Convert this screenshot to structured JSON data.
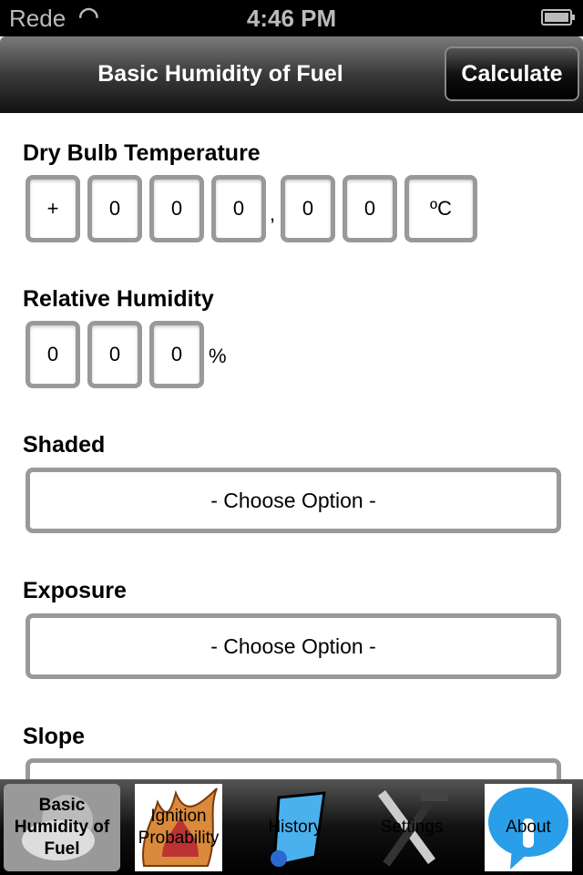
{
  "status_bar": {
    "carrier": "Rede",
    "time": "4:46 PM",
    "wifi_icon": "wifi-icon",
    "battery_icon": "battery-icon"
  },
  "nav": {
    "title": "Basic Humidity of Fuel",
    "calculate_label": "Calculate"
  },
  "dry_bulb": {
    "label": "Dry Bulb Temperature",
    "sign": "+",
    "digits": [
      "0",
      "0",
      "0",
      "0",
      "0"
    ],
    "decimal_separator": ",",
    "unit": "ºC"
  },
  "humidity": {
    "label": "Relative Humidity",
    "digits": [
      "0",
      "0",
      "0"
    ],
    "unit": "%"
  },
  "shaded": {
    "label": "Shaded",
    "value": "- Choose Option -"
  },
  "exposure": {
    "label": "Exposure",
    "value": "- Choose Option -"
  },
  "slope": {
    "label": "Slope"
  },
  "tabs": [
    {
      "label": "Basic Humidity of Fuel",
      "selected": true
    },
    {
      "label": "Ignition Probability"
    },
    {
      "label": "History"
    },
    {
      "label": "Settings"
    },
    {
      "label": "About"
    }
  ]
}
